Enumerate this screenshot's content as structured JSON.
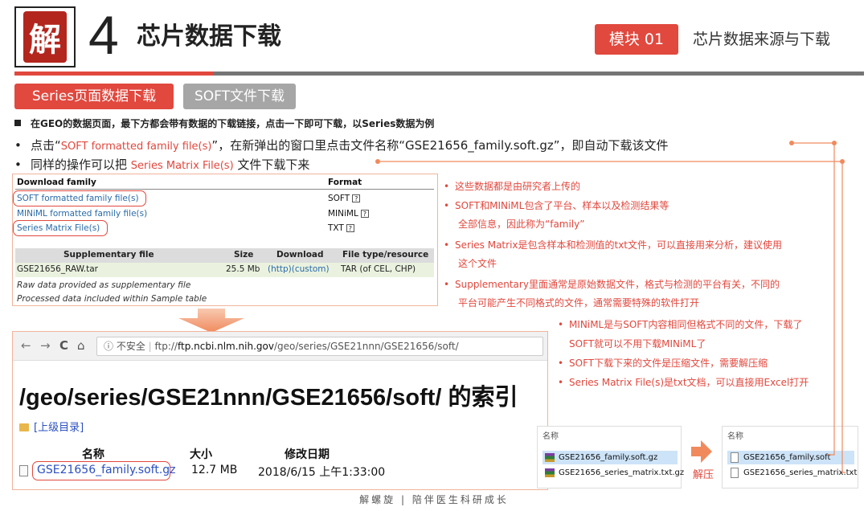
{
  "header": {
    "logo_char": "解",
    "chapter_number": "4",
    "chapter_title": "芯片数据下载",
    "module_badge": "模块 01",
    "module_name": "芯片数据来源与下载"
  },
  "tabs": [
    {
      "label": "Series页面数据下载",
      "active": true
    },
    {
      "label": "SOFT文件下载",
      "active": false
    }
  ],
  "bullets": {
    "b1": "在GEO的数据页面，最下方都会带有数据的下载链接，点击一下即可下载，以Series数据为例",
    "b2_pre": "点击“",
    "b2_red": "SOFT formatted family file(s)",
    "b2_post": "”，在新弹出的窗口里点击文件名称“GSE21656_family.soft.gz”，即自动下载该文件",
    "b3_pre": "同样的操作可以把",
    "b3_red": "Series Matrix File(s)",
    "b3_post": "文件下载下来"
  },
  "geo_table": {
    "download_header": "Download family",
    "format_header": "Format",
    "rows": [
      {
        "link": "SOFT formatted family file(s)",
        "format": "SOFT"
      },
      {
        "link": "MINiML formatted family file(s)",
        "format": "MINiML"
      },
      {
        "link": "Series Matrix File(s)",
        "format": "TXT"
      }
    ],
    "help_glyph": "?",
    "supp_headers": [
      "Supplementary file",
      "Size",
      "Download",
      "File type/resource"
    ],
    "supp_row": {
      "file": "GSE21656_RAW.tar",
      "size": "25.5 Mb",
      "download": "(http)(custom)",
      "type": "TAR (of CEL, CHP)"
    },
    "note1": "Raw data provided as supplementary file",
    "note2": "Processed data included within Sample table"
  },
  "notes": [
    "这些数据都是由研究者上传的",
    "SOFT和MINiML包含了平台、样本以及检测结果等",
    "全部信息，因此称为“family”",
    "Series Matrix是包含样本和检测值的txt文件，可以直接用来分析，建议使用",
    "这个文件",
    "Supplementary里面通常是原始数据文件，格式与检测的平台有关，不同的",
    "平台可能产生不同格式的文件，通常需要特殊的软件打开"
  ],
  "sub_notes": [
    "MINiML是与SOFT内容相同但格式不同的文件，下载了",
    "SOFT就可以不用下载MINiML了",
    "SOFT下载下来的文件是压缩文件，需要解压缩",
    "Series Matrix File(s)是txt文档，可以直接用Excel打开"
  ],
  "bullet_glyph": "•",
  "browser": {
    "back": "←",
    "forward": "→",
    "reload": "C",
    "home": "⌂",
    "security": "ⓘ 不安全",
    "url_prefix": "ftp://",
    "url_host": "ftp.ncbi.nlm.nih.gov",
    "url_path": "/geo/series/GSE21nnn/GSE21656/soft/",
    "page_title": "/geo/series/GSE21nnn/GSE21656/soft/ 的索引",
    "parent_dir": "[上级目录]",
    "columns": [
      "名称",
      "大小",
      "修改日期"
    ],
    "file": {
      "name": "GSE21656_family.soft.gz",
      "size": "12.7 MB",
      "date": "2018/6/15 上午1:33:00"
    }
  },
  "explorer_left": {
    "header": "名称",
    "rows": [
      "GSE21656_family.soft.gz",
      "GSE21656_series_matrix.txt.gz"
    ]
  },
  "explorer_right": {
    "header": "名称",
    "rows": [
      "GSE21656_family.soft",
      "GSE21656_series_matrix.txt"
    ]
  },
  "unzip_label": "解压",
  "footer": "解螺旋  |  陪伴医生科研成长",
  "colors": {
    "accent": "#e1483e",
    "link": "#2a6aa8",
    "gray_tab": "#a6a6a6"
  }
}
